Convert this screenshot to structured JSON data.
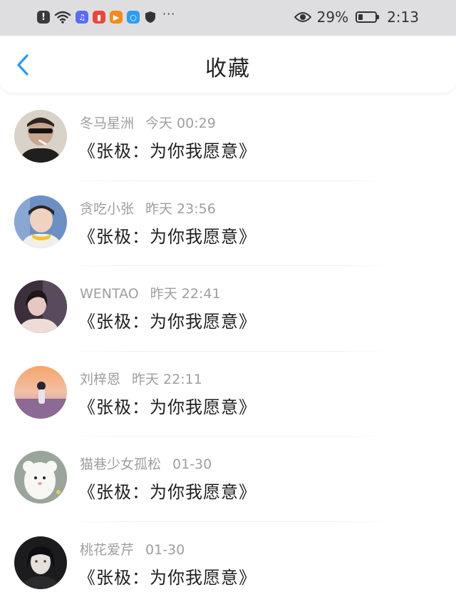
{
  "status_bar": {
    "battery_percent": "29%",
    "battery_level": 0.29,
    "time": "2:13",
    "icons": [
      "alert-icon",
      "wifi-icon",
      "music-app-icon",
      "book-app-icon",
      "video-app-icon",
      "search-app-icon",
      "shield-icon",
      "more-icon",
      "eye-icon",
      "battery-icon"
    ]
  },
  "nav": {
    "title": "收藏",
    "back_icon": "chevron-left-icon",
    "accent_color": "#2b9af3"
  },
  "favorites": [
    {
      "user": "冬马星洲",
      "time": "今天 00:29",
      "content": "《张极：为你我愿意》"
    },
    {
      "user": "贪吃小张",
      "time": "昨天 23:56",
      "content": "《张极：为你我愿意》"
    },
    {
      "user": "WENTAO",
      "time": "昨天 22:41",
      "content": "《张极：为你我愿意》"
    },
    {
      "user": "刘梓恩",
      "time": "昨天 22:11",
      "content": "《张极：为你我愿意》"
    },
    {
      "user": "猫巷少女孤松",
      "time": "01-30",
      "content": "《张极：为你我愿意》"
    },
    {
      "user": "桃花爱芹",
      "time": "01-30",
      "content": "《张极：为你我愿意》"
    }
  ]
}
